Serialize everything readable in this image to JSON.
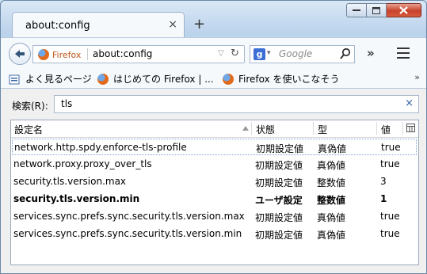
{
  "tab": {
    "title": "about:config",
    "close": "×",
    "new_tab": "+"
  },
  "navbar": {
    "identity_label": "Firefox",
    "url": "about:config",
    "search_engine_letter": "g",
    "search_placeholder": "Google",
    "overflow": "»"
  },
  "bookmarks": {
    "items": [
      {
        "label": "よく見るページ"
      },
      {
        "label": "はじめての Firefox | ..."
      },
      {
        "label": "Firefox を使いこなそう"
      }
    ],
    "more": "»"
  },
  "filter": {
    "label": "検索(R):",
    "value": "tls",
    "clear": "×"
  },
  "columns": {
    "name": "設定名",
    "status": "状態",
    "type": "型",
    "value": "値"
  },
  "rows": [
    {
      "name": "network.http.spdy.enforce-tls-profile",
      "status": "初期設定値",
      "type": "真偽値",
      "value": "true",
      "modified": false
    },
    {
      "name": "network.proxy.proxy_over_tls",
      "status": "初期設定値",
      "type": "真偽値",
      "value": "true",
      "modified": false
    },
    {
      "name": "security.tls.version.max",
      "status": "初期設定値",
      "type": "整数値",
      "value": "3",
      "modified": false
    },
    {
      "name": "security.tls.version.min",
      "status": "ユーザ設定",
      "type": "整数値",
      "value": "1",
      "modified": true
    },
    {
      "name": "services.sync.prefs.sync.security.tls.version.max",
      "status": "初期設定値",
      "type": "真偽値",
      "value": "true",
      "modified": false
    },
    {
      "name": "services.sync.prefs.sync.security.tls.version.min",
      "status": "初期設定値",
      "type": "真偽値",
      "value": "true",
      "modified": false
    }
  ],
  "colors": {
    "accent": "#3b6fd6",
    "firefox_label": "#c0561c",
    "close_button": "#c7412a"
  }
}
